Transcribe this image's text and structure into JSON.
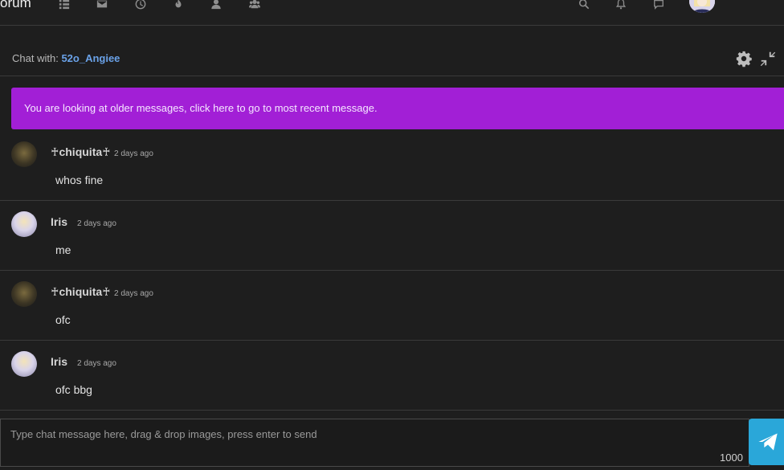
{
  "nav": {
    "brand": "orum",
    "icons": [
      "list-icon",
      "inbox-icon",
      "clock-icon",
      "fire-icon",
      "user-icon",
      "users-icon",
      "search-icon",
      "bell-icon",
      "chat-icon"
    ]
  },
  "chat": {
    "label": "Chat with:",
    "partner": "52o_Angiee"
  },
  "banner": {
    "text": "You are looking at older messages, click here to go to most recent message."
  },
  "messages": [
    {
      "user": "♰chiquita♰",
      "time": "2 days ago",
      "text": "whos fine",
      "avatar": "dark"
    },
    {
      "user": "Iris",
      "time": "2 days ago",
      "text": "me",
      "avatar": "light"
    },
    {
      "user": "♰chiquita♰",
      "time": "2 days ago",
      "text": "ofc",
      "avatar": "dark"
    },
    {
      "user": "Iris",
      "time": "2 days ago",
      "text": "ofc bbg",
      "avatar": "light"
    }
  ],
  "composer": {
    "placeholder": "Type chat message here, drag & drop images, press enter to send",
    "counter": "1000"
  },
  "colors": {
    "banner": "#a21fd6",
    "link": "#6aa2e8",
    "send": "#2aa7d9"
  }
}
